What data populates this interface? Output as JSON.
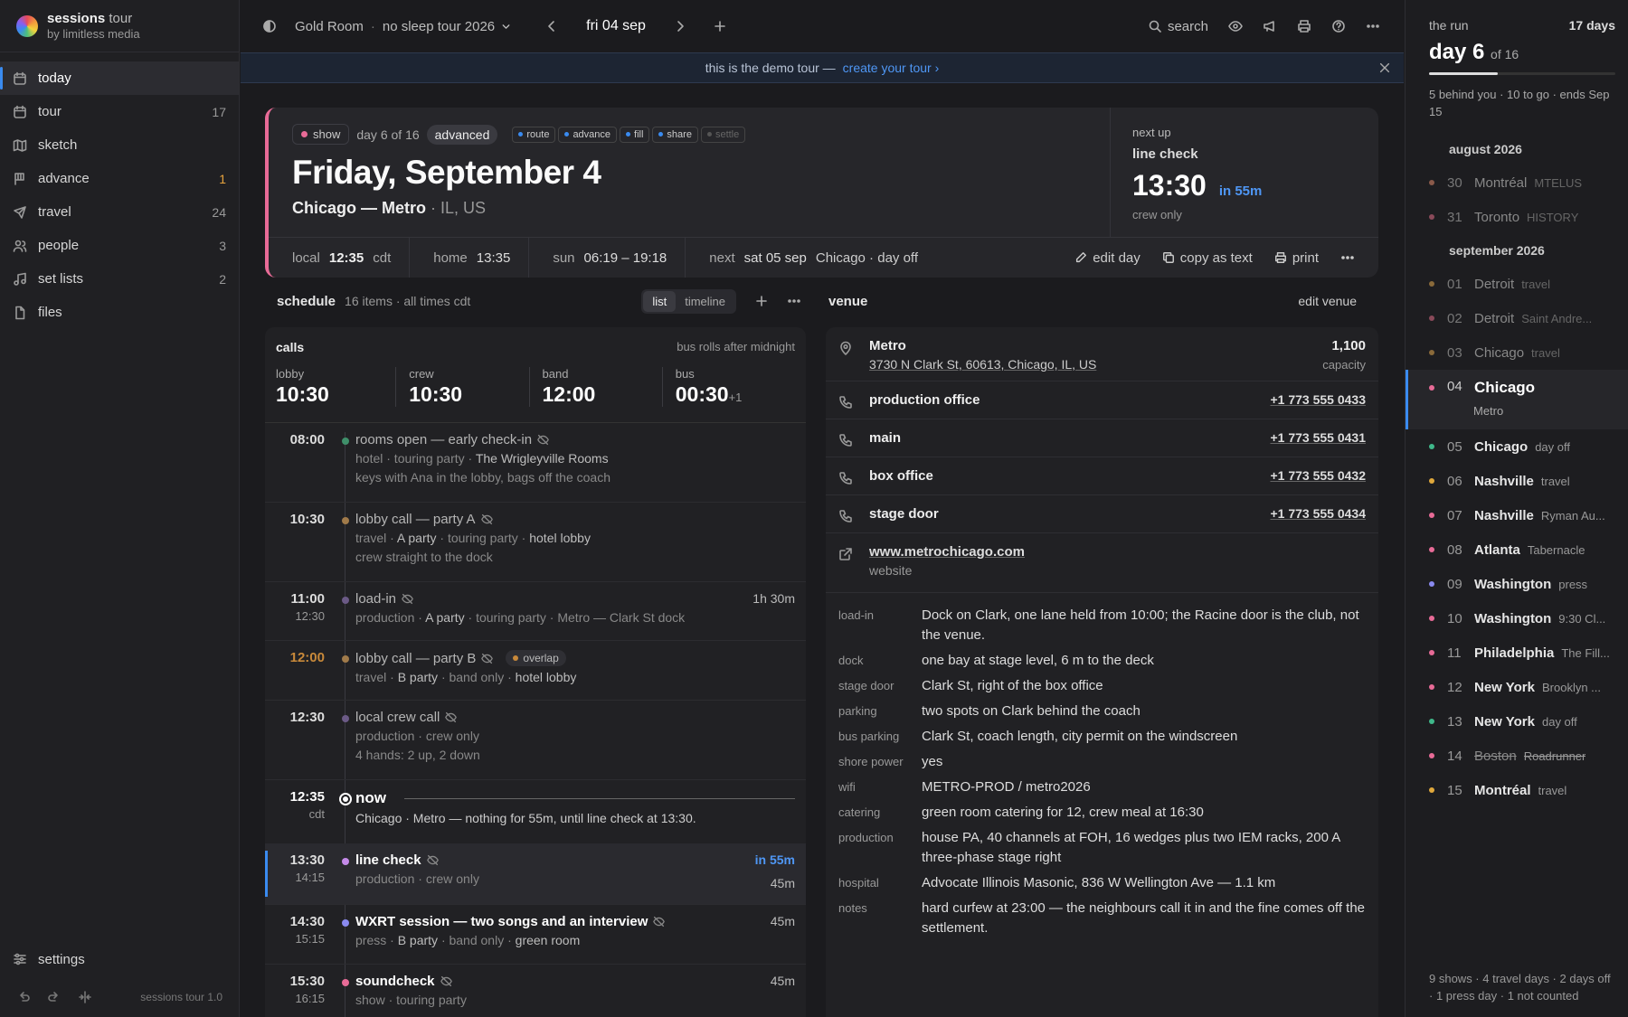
{
  "brand": {
    "name": "sessions",
    "name_suffix": "tour",
    "sub": "by limitless media"
  },
  "nav": [
    {
      "label": "today",
      "count": "",
      "icon": "calendar-icon"
    },
    {
      "label": "tour",
      "count": "17",
      "icon": "calendar-icon"
    },
    {
      "label": "sketch",
      "count": "",
      "icon": "map-icon"
    },
    {
      "label": "advance",
      "count": "1",
      "icon": "flag-icon"
    },
    {
      "label": "travel",
      "count": "24",
      "icon": "plane-icon"
    },
    {
      "label": "people",
      "count": "3",
      "icon": "people-icon"
    },
    {
      "label": "set lists",
      "count": "2",
      "icon": "music-icon"
    },
    {
      "label": "files",
      "count": "",
      "icon": "file-icon"
    }
  ],
  "sidebar_bottom": {
    "settings": "settings",
    "version": "sessions tour 1.0"
  },
  "topbar": {
    "room": "Gold Room",
    "tour": "no sleep tour 2026",
    "date": "fri 04 sep",
    "search": "search"
  },
  "banner": {
    "text": "this is the demo tour —",
    "link": "create your tour ›"
  },
  "day": {
    "type": "show",
    "day_of": "day 6 of 16",
    "stage": "advanced",
    "stages": [
      "route",
      "advance",
      "fill",
      "share",
      "settle"
    ],
    "title": "Friday, September 4",
    "city": "Chicago — Metro",
    "region": "· IL, US",
    "next_up": {
      "label": "next up",
      "what": "line check",
      "time": "13:30",
      "in": "in 55m",
      "who": "crew only"
    },
    "foot": {
      "local_k": "local",
      "local_v": "12:35",
      "local_tz": "cdt",
      "home_k": "home",
      "home_v": "13:35",
      "sun_k": "sun",
      "sun_v": "06:19 – 19:18",
      "next_k": "next",
      "next_v": "sat 05 sep",
      "next_rest": "Chicago · day off"
    },
    "actions": {
      "edit": "edit day",
      "copy": "copy as text",
      "print": "print"
    }
  },
  "schedule": {
    "label": "schedule",
    "meta": "16 items · all times cdt",
    "views": [
      "list",
      "timeline"
    ],
    "calls_title": "calls",
    "calls_note": "bus rolls after midnight",
    "calls": [
      {
        "k": "lobby",
        "v": "10:30",
        "extra": ""
      },
      {
        "k": "crew",
        "v": "10:30",
        "extra": ""
      },
      {
        "k": "band",
        "v": "12:00",
        "extra": ""
      },
      {
        "k": "bus",
        "v": "00:30",
        "extra": "+1"
      }
    ],
    "rows": [
      {
        "t": "08:00",
        "end": "",
        "dot": "#3f8f6a",
        "title": "rooms open — early check-in",
        "sub_a": "hotel · touring party ·",
        "sub_b": "The Wrigleyville Rooms",
        "note": "keys with Ana in the lobby, bags off the coach",
        "dur": ""
      },
      {
        "t": "10:30",
        "end": "",
        "dot": "#a07a4a",
        "title": "lobby call — party A",
        "sub_a": "travel ·",
        "sub_b": "A party",
        "sub_c": "· touring party ·",
        "sub_d": "hotel lobby",
        "note": "crew straight to the dock",
        "dur": ""
      },
      {
        "t": "11:00",
        "end": "12:30",
        "dot": "#6b5a86",
        "title": "load-in",
        "sub_a": "production ·",
        "sub_b": "A party",
        "sub_c": "· touring party · Metro — Clark St dock",
        "note": "",
        "dur": "1h 30m"
      },
      {
        "t": "12:00",
        "end": "",
        "dot": "#a07a4a",
        "title": "lobby call — party B",
        "overlap": "overlap",
        "sub_a": "travel ·",
        "sub_b": "B party",
        "sub_c": "· band only ·",
        "sub_d": "hotel lobby",
        "note": "",
        "dur": ""
      },
      {
        "t": "12:30",
        "end": "",
        "dot": "#6b5a86",
        "title": "local crew call",
        "sub_a": "production · crew only",
        "note": "4 hands: 2 up, 2 down",
        "dur": ""
      }
    ],
    "now": {
      "t": "12:35",
      "tz": "cdt",
      "title": "now",
      "sub": "Chicago · Metro — nothing for 55m, until line check at 13:30."
    },
    "line_check": {
      "t": "13:30",
      "end": "14:15",
      "title": "line check",
      "sub": "production · crew only",
      "in": "in 55m",
      "dur": "45m"
    },
    "wxrt": {
      "t": "14:30",
      "end": "15:15",
      "title": "WXRT session — two songs and an interview",
      "sub_a": "press ·",
      "sub_b": "B party",
      "sub_c": "· band only ·",
      "sub_d": "green room",
      "dur": "45m"
    },
    "soundcheck": {
      "t": "15:30",
      "end": "16:15",
      "title": "soundcheck",
      "sub": "show · touring party",
      "dur": "45m"
    }
  },
  "venue": {
    "label": "venue",
    "edit": "edit venue",
    "name": "Metro",
    "address": "3730 N Clark St, 60613, Chicago, IL, US",
    "capacity": "1,100",
    "capacity_label": "capacity",
    "phones": [
      {
        "k": "production office",
        "v": "+1 773 555 0433"
      },
      {
        "k": "main",
        "v": "+1 773 555 0431"
      },
      {
        "k": "box office",
        "v": "+1 773 555 0432"
      },
      {
        "k": "stage door",
        "v": "+1 773 555 0434"
      }
    ],
    "website": "www.metrochicago.com",
    "website_label": "website",
    "info": [
      {
        "k": "load-in",
        "v": "Dock on Clark, one lane held from 10:00; the Racine door is the club, not the venue."
      },
      {
        "k": "dock",
        "v": "one bay at stage level, 6 m to the deck"
      },
      {
        "k": "stage door",
        "v": "Clark St, right of the box office"
      },
      {
        "k": "parking",
        "v": "two spots on Clark behind the coach"
      },
      {
        "k": "bus parking",
        "v": "Clark St, coach length, city permit on the windscreen"
      },
      {
        "k": "shore power",
        "v": "yes"
      },
      {
        "k": "wifi",
        "v": "METRO-PROD / metro2026"
      },
      {
        "k": "catering",
        "v": "green room catering for 12, crew meal at 16:30"
      },
      {
        "k": "production",
        "v": "house PA, 40 channels at FOH, 16 wedges plus two IEM racks, 200 A three-phase stage right"
      },
      {
        "k": "hospital",
        "v": "Advocate Illinois Masonic, 836 W Wellington Ave — 1.1 km"
      },
      {
        "k": "notes",
        "v": "hard curfew at 23:00 — the neighbours call it in and the fine comes off the settlement."
      }
    ]
  },
  "run": {
    "label": "the run",
    "days": "17 days",
    "day": "day 6",
    "of": "of 16",
    "progress": 0.37,
    "stat": "5 behind you · 10 to go · ends Sep 15",
    "aug": "august 2026",
    "sep": "september 2026",
    "aug_days": [
      {
        "n": "30",
        "c": "Montréal",
        "s": "MTELUS",
        "dot": "#8a5a4a"
      },
      {
        "n": "31",
        "c": "Toronto",
        "s": "HISTORY",
        "dot": "#8a4a5a"
      }
    ],
    "sep_days": [
      {
        "n": "01",
        "c": "Detroit",
        "s": "travel",
        "dot": "#8a6a3a",
        "state": "past"
      },
      {
        "n": "02",
        "c": "Detroit",
        "s": "Saint Andre...",
        "dot": "#8a4a5a",
        "state": "past"
      },
      {
        "n": "03",
        "c": "Chicago",
        "s": "travel",
        "dot": "#8a6a3a",
        "state": "past"
      },
      {
        "n": "04",
        "c": "Chicago",
        "s": "Metro",
        "dot": "#e86b97",
        "state": "cur"
      },
      {
        "n": "05",
        "c": "Chicago",
        "s": "day off",
        "dot": "#3fb88a",
        "state": ""
      },
      {
        "n": "06",
        "c": "Nashville",
        "s": "travel",
        "dot": "#e0a83c",
        "state": ""
      },
      {
        "n": "07",
        "c": "Nashville",
        "s": "Ryman Au...",
        "dot": "#e86b97",
        "state": ""
      },
      {
        "n": "08",
        "c": "Atlanta",
        "s": "Tabernacle",
        "dot": "#e86b97",
        "state": ""
      },
      {
        "n": "09",
        "c": "Washington",
        "s": "press",
        "dot": "#8a8af0",
        "state": ""
      },
      {
        "n": "10",
        "c": "Washington",
        "s": "9:30 Cl...",
        "dot": "#e86b97",
        "state": ""
      },
      {
        "n": "11",
        "c": "Philadelphia",
        "s": "The Fill...",
        "dot": "#e86b97",
        "state": ""
      },
      {
        "n": "12",
        "c": "New York",
        "s": "Brooklyn ...",
        "dot": "#e86b97",
        "state": ""
      },
      {
        "n": "13",
        "c": "New York",
        "s": "day off",
        "dot": "#3fb88a",
        "state": ""
      },
      {
        "n": "14",
        "c": "Boston",
        "s": "Roadrunner",
        "dot": "#e86b97",
        "state": "strike"
      },
      {
        "n": "15",
        "c": "Montréal",
        "s": "travel",
        "dot": "#e0a83c",
        "state": ""
      }
    ],
    "foot": "9 shows · 4 travel days · 2 days off · 1 press day · 1 not counted"
  }
}
